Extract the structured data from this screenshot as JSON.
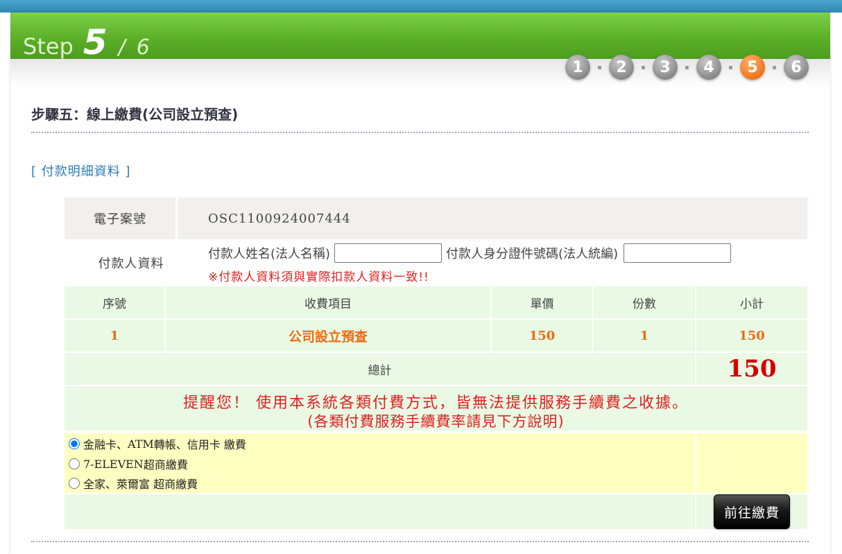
{
  "header": {
    "step_word": "Step",
    "step_current": "5",
    "step_separator": "/",
    "step_total": "6",
    "steps": [
      "1",
      "2",
      "3",
      "4",
      "5",
      "6"
    ],
    "active_step": 5
  },
  "page": {
    "title": "步驟五：線上繳費(公司設立預查)",
    "section_link": "[ 付款明細資料 ]"
  },
  "case": {
    "label": "電子案號",
    "value": "OSC1100924007444"
  },
  "payer": {
    "label": "付款人資料",
    "name_label": "付款人姓名(法人名稱)",
    "name_value": "",
    "id_label": "付款人身分證件號碼(法人統編)",
    "id_value": "",
    "note": "※付款人資料須與實際扣款人資料一致!!"
  },
  "fee_table": {
    "headers": [
      "序號",
      "收費項目",
      "單價",
      "份數",
      "小計"
    ],
    "rows": [
      {
        "no": "1",
        "item": "公司設立預查",
        "price": "150",
        "qty": "1",
        "subtotal": "150"
      }
    ],
    "total_label": "總計",
    "total_value": "150"
  },
  "notice": {
    "line1": "提醒您！ 使用本系統各類付費方式，皆無法提供服務手續費之收據。",
    "line2": "(各類付費服務手續費率請見下方說明)"
  },
  "payment_options": [
    {
      "prefix": "金融卡、",
      "serif": "ATM",
      "suffix": "轉帳、信用卡 繳費",
      "checked": true
    },
    {
      "prefix": "",
      "serif": "7-ELEVEN",
      "suffix": " 超商繳費",
      "checked": false
    },
    {
      "prefix": "全家、萊爾富 超商繳費",
      "serif": "",
      "suffix": "",
      "checked": false
    }
  ],
  "actions": {
    "pay_button": "前往繳費"
  },
  "colors": {
    "banner_green": "#5cb027",
    "active_step_orange": "#f07a20",
    "inactive_step_gray": "#8a8a8a",
    "table_green": "#e9f9e4",
    "options_yellow": "#ffffc2",
    "warning_red": "#e02020",
    "amount_orange": "#ec6b12",
    "total_red": "#d40000",
    "link_blue": "#2b7bb5"
  }
}
